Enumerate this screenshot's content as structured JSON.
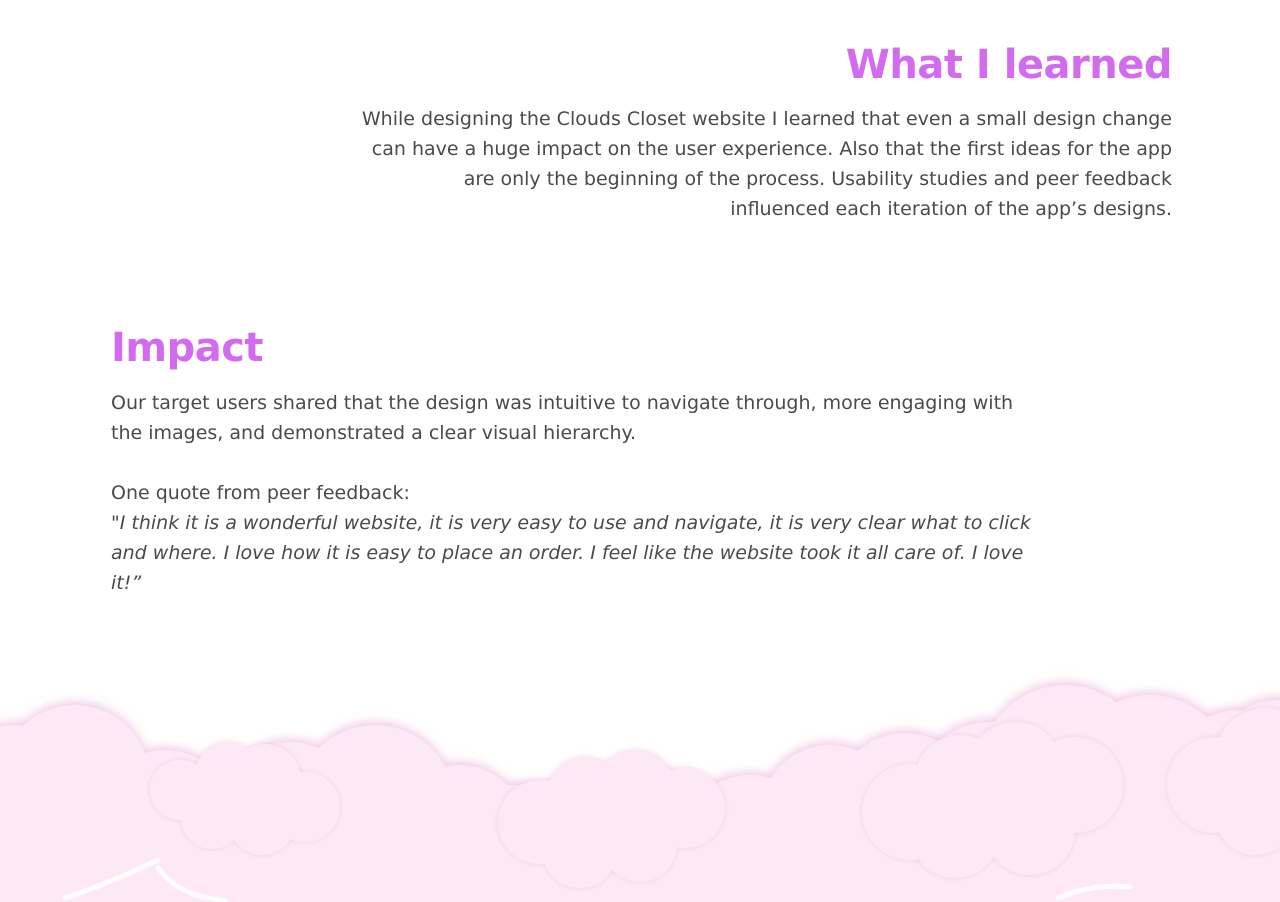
{
  "colors": {
    "heading": "#d36bee",
    "text": "#4a4a4a",
    "cloud_fill": "#fde9f6",
    "cloud_shadow": "#ecb6dc"
  },
  "learned": {
    "title": "What I learned",
    "body": "While designing the Clouds Closet website I learned that even a small design change can have a huge impact on the user experience. Also that the first ideas for the app are only the beginning of the process. Usability studies and peer feedback influenced each iteration of the app’s designs."
  },
  "impact": {
    "title": "Impact",
    "body": "Our target users shared that the design was intuitive to navigate through, more engaging with the images, and demonstrated a clear visual hierarchy.",
    "quote_intro": "One quote from peer feedback:",
    "quote": "\"I think it is a wonderful website, it is very easy to use and navigate, it is very clear what to click and where. I love how it is easy to place an order. I feel like the website took it all care of. I love it!”"
  },
  "decoration": {
    "icon": "pink-clouds-illustration"
  }
}
